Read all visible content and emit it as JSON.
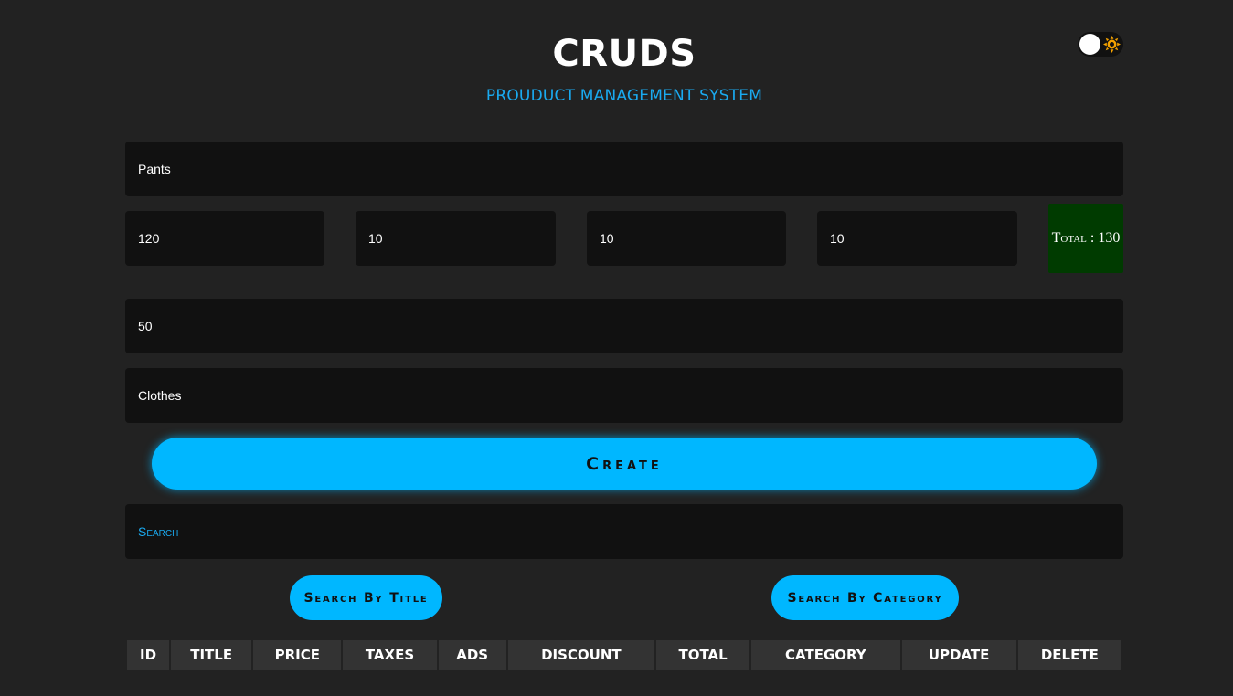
{
  "header": {
    "title": "CRUDS",
    "subtitle": "PROUDUCT MANAGEMENT SYSTEM"
  },
  "theme_toggle": {
    "icon": "sun-icon",
    "state": "dark"
  },
  "form": {
    "title_value": "Pants",
    "price_value": "120",
    "taxes_value": "10",
    "ads_value": "10",
    "discount_value": "10",
    "total_label": "Total : 130",
    "count_value": "50",
    "category_value": "Clothes",
    "create_label": "Create"
  },
  "search": {
    "placeholder": "Search",
    "by_title_label": "Search By Title",
    "by_category_label": "Search By Category"
  },
  "table": {
    "columns": [
      "ID",
      "TITLE",
      "PRICE",
      "TAXES",
      "ADS",
      "DISCOUNT",
      "TOTAL",
      "CATEGORY",
      "UPDATE",
      "DELETE"
    ]
  },
  "colors": {
    "background": "#222222",
    "field": "#111111",
    "accent": "#00b7ff",
    "total_box": "#003b00",
    "header_cell": "#333333"
  }
}
